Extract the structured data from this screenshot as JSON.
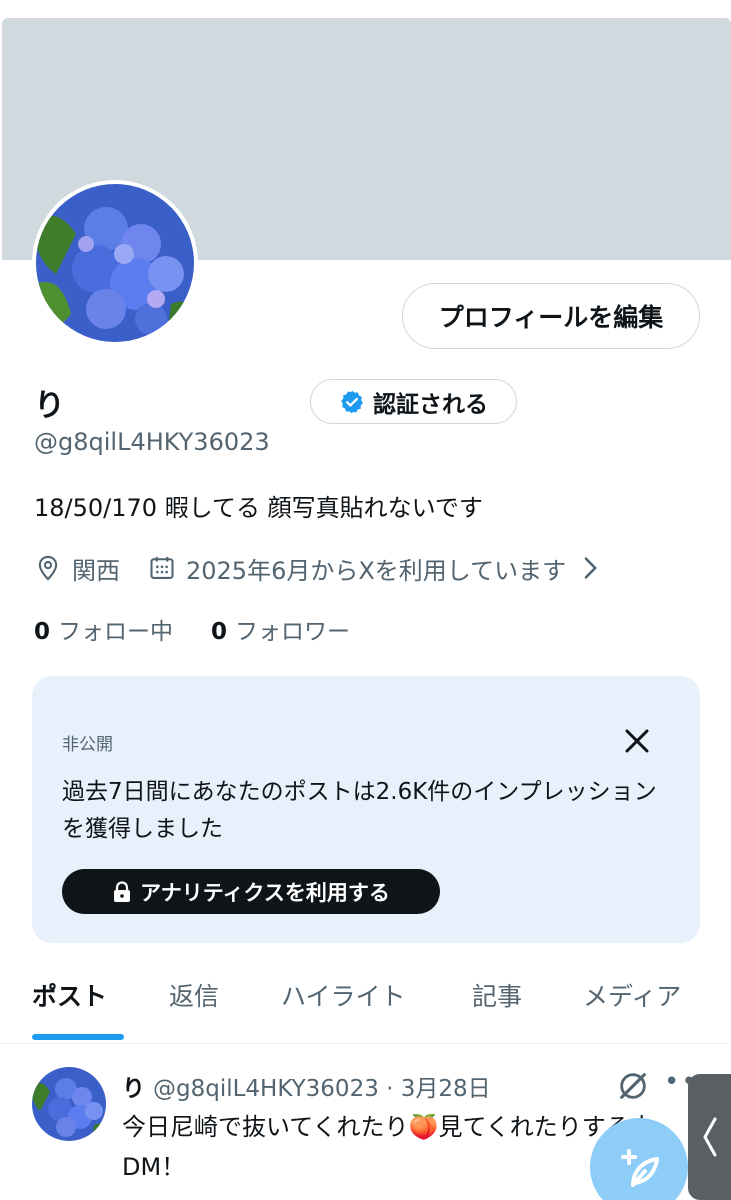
{
  "profile": {
    "edit_button": "プロフィールを編集",
    "name": "り",
    "verify_button": "認証される",
    "handle": "@g8qilL4HKY36023",
    "bio": "18/50/170  暇してる 顔写真貼れないです",
    "location": "関西",
    "joined": "2025年6月からXを利用しています",
    "following_count": "0",
    "following_label": "フォロー中",
    "followers_count": "0",
    "followers_label": "フォロワー"
  },
  "analytics_card": {
    "private_label": "非公開",
    "message": "過去7日間にあなたのポストは2.6K件のインプレッションを獲得しました",
    "button_label": "アナリティクスを利用する"
  },
  "tabs": [
    {
      "label": "ポスト",
      "active": true
    },
    {
      "label": "返信",
      "active": false
    },
    {
      "label": "ハイライト",
      "active": false
    },
    {
      "label": "記事",
      "active": false
    },
    {
      "label": "メディア",
      "active": false
    }
  ],
  "post": {
    "name": "り",
    "handle_and_date": "@g8qilL4HKY36023 · 3月28日",
    "text": "今日尼崎で抜いてくれたり🍑見てくれたりする人DM！"
  },
  "colors": {
    "accent": "#1d9bf0",
    "banner": "#cfd9de",
    "card_bg": "#e8f1fb",
    "text_primary": "#0f1419",
    "text_secondary": "#536471",
    "fab": "#8ecdf8"
  },
  "icons": [
    "verified-badge-icon",
    "location-pin-icon",
    "calendar-icon",
    "chevron-right-icon",
    "close-icon",
    "lock-icon",
    "grok-icon",
    "more-icon",
    "compose-post-icon",
    "side-panel-handle-icon"
  ]
}
